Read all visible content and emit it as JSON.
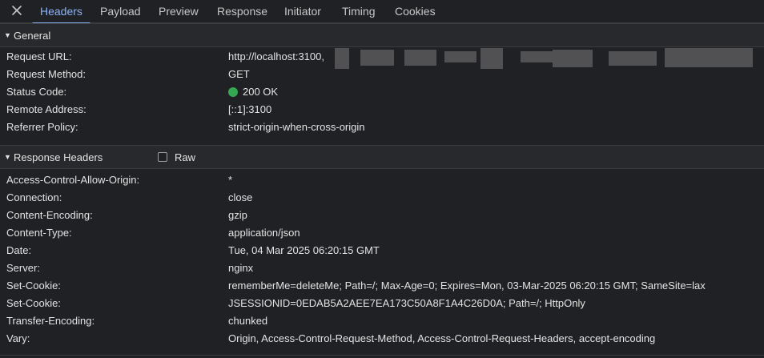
{
  "tabs": {
    "close_label": "",
    "items": [
      "Headers",
      "Payload",
      "Preview",
      "Response",
      "Initiator",
      "Timing",
      "Cookies"
    ],
    "active": "Headers"
  },
  "general": {
    "title": "General",
    "rows": [
      {
        "key": "Request URL:",
        "value": "http://localhost:3100,"
      },
      {
        "key": "Request Method:",
        "value": "GET"
      },
      {
        "key": "Status Code:",
        "value": "200 OK"
      },
      {
        "key": "Remote Address:",
        "value": "[::1]:3100"
      },
      {
        "key": "Referrer Policy:",
        "value": "strict-origin-when-cross-origin"
      }
    ]
  },
  "response_headers": {
    "title": "Response Headers",
    "raw_label": "Raw",
    "rows": [
      {
        "key": "Access-Control-Allow-Origin:",
        "value": "*"
      },
      {
        "key": "Connection:",
        "value": "close"
      },
      {
        "key": "Content-Encoding:",
        "value": "gzip"
      },
      {
        "key": "Content-Type:",
        "value": "application/json"
      },
      {
        "key": "Date:",
        "value": "Tue, 04 Mar 2025 06:20:15 GMT"
      },
      {
        "key": "Server:",
        "value": "nginx"
      },
      {
        "key": "Set-Cookie:",
        "value": "rememberMe=deleteMe; Path=/; Max-Age=0; Expires=Mon, 03-Mar-2025 06:20:15 GMT; SameSite=lax"
      },
      {
        "key": "Set-Cookie:",
        "value": "JSESSIONID=0EDAB5A2AEE7EA173C50A8F1A4C26D0A; Path=/; HttpOnly"
      },
      {
        "key": "Transfer-Encoding:",
        "value": "chunked"
      },
      {
        "key": "Vary:",
        "value": "Origin, Access-Control-Request-Method, Access-Control-Request-Headers, accept-encoding"
      }
    ]
  },
  "colors": {
    "background": "#202124",
    "active_tab": "#8ab4f8",
    "status_ok": "#34a853"
  }
}
